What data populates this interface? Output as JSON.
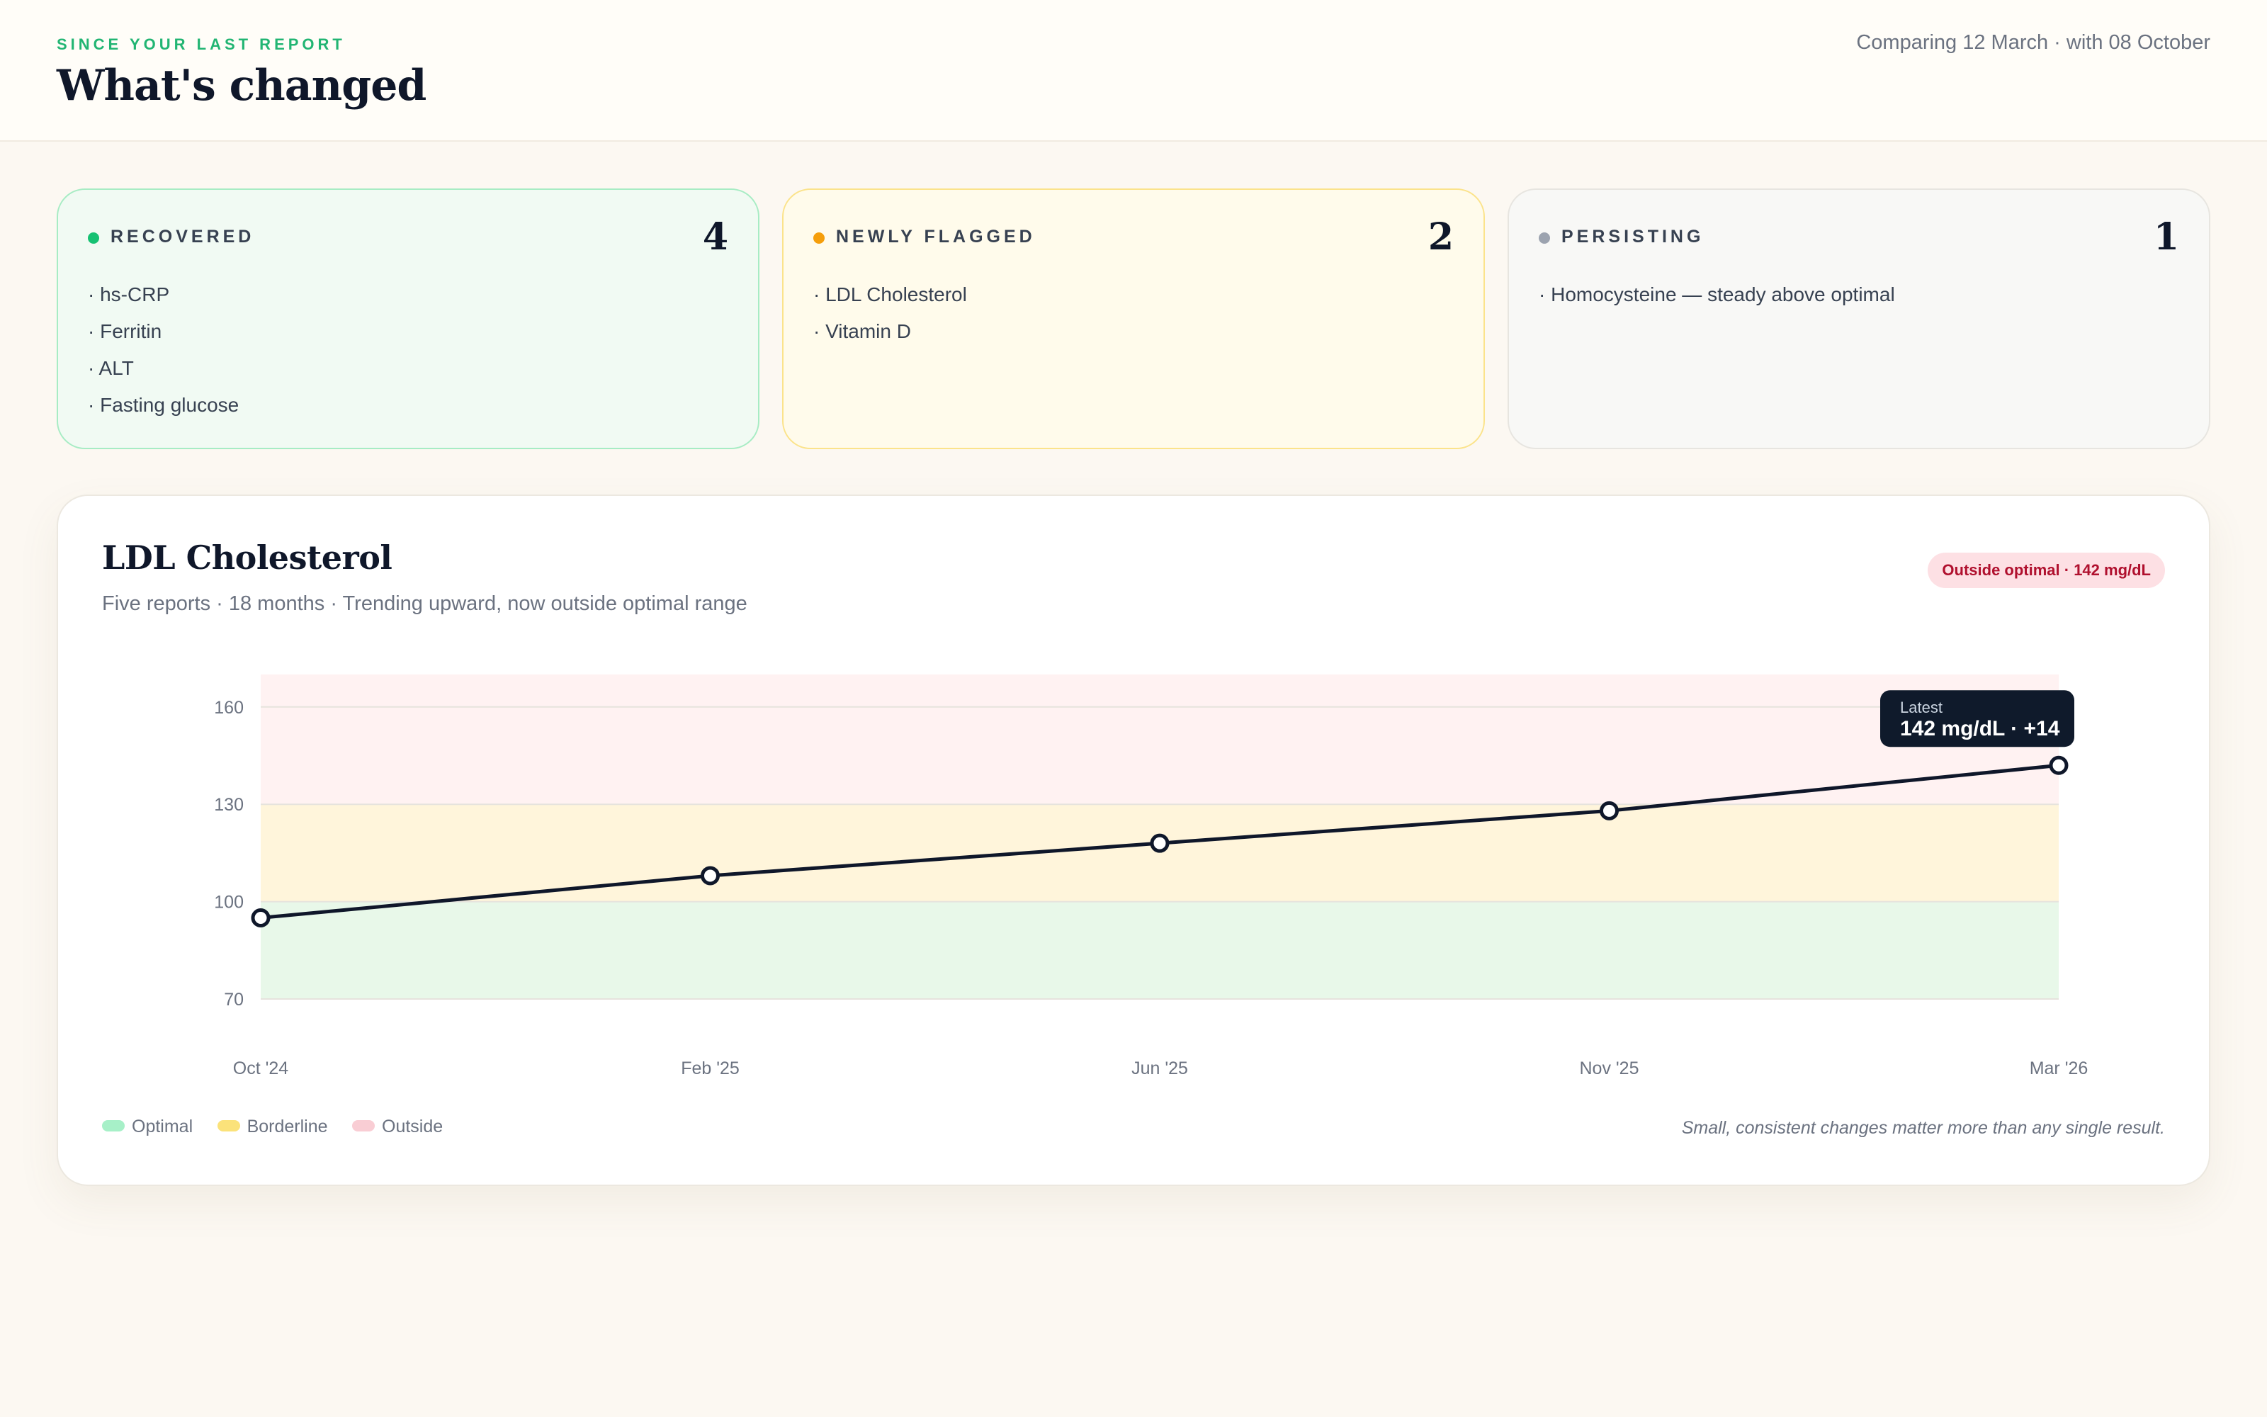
{
  "header": {
    "eyebrow": "SINCE YOUR LAST REPORT",
    "title": "What's changed",
    "comparison": "Comparing 12 March · with 08 October"
  },
  "cards": [
    {
      "label": "RECOVERED",
      "count": "4",
      "dot_color": "#16c172",
      "items": [
        "· hs-CRP",
        "· Ferritin",
        "· ALT",
        "· Fasting glucose"
      ]
    },
    {
      "label": "NEWLY FLAGGED",
      "count": "2",
      "dot_color": "#f59e0b",
      "items": [
        "· LDL Cholesterol",
        "· Vitamin D"
      ]
    },
    {
      "label": "PERSISTING",
      "count": "1",
      "dot_color": "#9ca3af",
      "items": [
        "· Homocysteine — steady above optimal"
      ]
    }
  ],
  "chart_section": {
    "title": "LDL Cholesterol",
    "subtitle": "Five reports · 18 months · Trending upward, now outside optimal range",
    "badge": "Outside optimal · 142 mg/dL",
    "tooltip_label": "Latest",
    "tooltip_value": "142 mg/dL · +14",
    "legend": [
      {
        "label": "Optimal",
        "color": "#a7f0c8"
      },
      {
        "label": "Borderline",
        "color": "#fbe27a"
      },
      {
        "label": "Outside",
        "color": "#f9cdd4"
      }
    ],
    "footnote": "Small, consistent changes matter more than any single result."
  },
  "chart_data": {
    "type": "line",
    "title": "LDL Cholesterol",
    "x": [
      "Oct '24",
      "Feb '25",
      "Jun '25",
      "Nov '25",
      "Mar '26"
    ],
    "series": [
      {
        "values": [
          95,
          108,
          118,
          128,
          142
        ]
      }
    ],
    "ylim": [
      70,
      170
    ],
    "yticks": [
      70,
      100,
      130,
      160
    ],
    "bands": [
      {
        "name": "Optimal",
        "from": 70,
        "to": 100,
        "color": "#e8f8e9"
      },
      {
        "name": "Borderline",
        "from": 100,
        "to": 130,
        "color": "#fff5db"
      },
      {
        "name": "Outside",
        "from": 130,
        "to": 170,
        "color": "#fff2f2"
      }
    ],
    "line_color": "#0f172a",
    "grid": true
  }
}
